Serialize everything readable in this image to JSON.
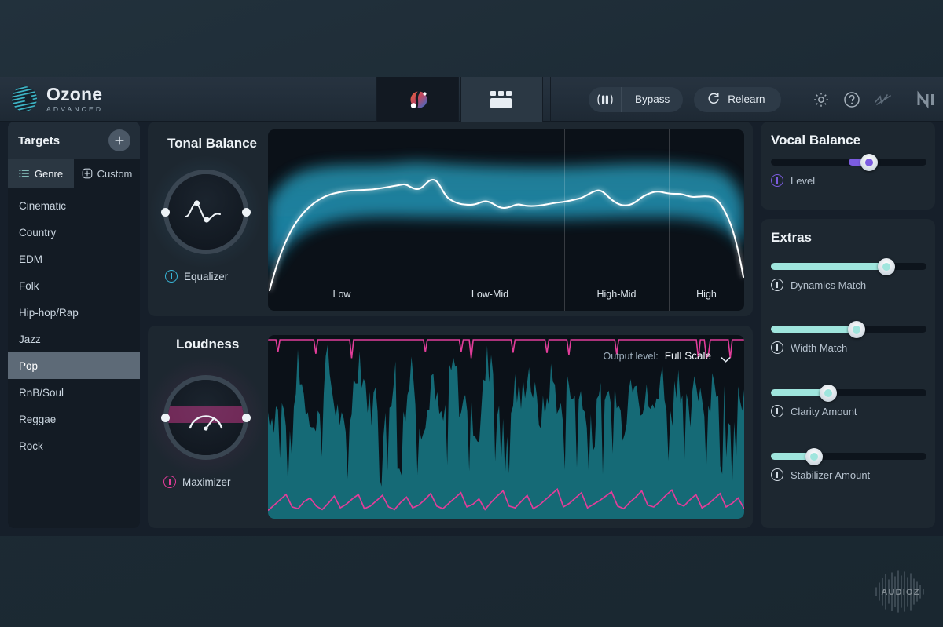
{
  "app": {
    "logo_title": "Ozone",
    "logo_sub": "ADVANCED"
  },
  "header": {
    "tab_assistant_icon": "assistant-orb-icon",
    "tab_modules_icon": "modules-grid-icon",
    "compare_icon": "ab-compare-icon",
    "bypass_label": "Bypass",
    "relearn_label": "Relearn",
    "relearn_icon": "refresh-icon",
    "settings_icon": "gear-icon",
    "help_icon": "help-circle-icon",
    "signal_icon": "signal-wave-icon",
    "brand_icon": "native-instruments-logo"
  },
  "sidebar": {
    "title": "Targets",
    "add_label": "+",
    "tabs": [
      {
        "label": "Genre",
        "icon": "list-icon",
        "active": true
      },
      {
        "label": "Custom",
        "icon": "plus-circle-icon",
        "active": false
      }
    ],
    "genres": [
      {
        "label": "Cinematic",
        "selected": false
      },
      {
        "label": "Country",
        "selected": false
      },
      {
        "label": "EDM",
        "selected": false
      },
      {
        "label": "Folk",
        "selected": false
      },
      {
        "label": "Hip-hop/Rap",
        "selected": false
      },
      {
        "label": "Jazz",
        "selected": false
      },
      {
        "label": "Pop",
        "selected": true
      },
      {
        "label": "RnB/Soul",
        "selected": false
      },
      {
        "label": "Reggae",
        "selected": false
      },
      {
        "label": "Rock",
        "selected": false
      }
    ]
  },
  "tonal_balance": {
    "title": "Tonal Balance",
    "knob_label": "Equalizer",
    "knob_icon": "eq-curve-icon",
    "knob_color": "#38b6d8",
    "bands": [
      "Low",
      "Low-Mid",
      "High-Mid",
      "High"
    ]
  },
  "loudness": {
    "title": "Loudness",
    "knob_label": "Maximizer",
    "knob_icon": "gauge-icon",
    "knob_color": "#e23d9a",
    "output_level_label": "Output level:",
    "output_level_value": "Full Scale",
    "chevron_icon": "chevron-down-icon"
  },
  "vocal_balance": {
    "title": "Vocal Balance",
    "slider": {
      "label": "Level",
      "value_pct": 63,
      "color": "#7c5ce0",
      "bipolar": true,
      "icon": "power-icon"
    }
  },
  "extras": {
    "title": "Extras",
    "sliders": [
      {
        "label": "Dynamics Match",
        "value_pct": 74,
        "color": "#9fe5dd",
        "icon": "power-icon"
      },
      {
        "label": "Width Match",
        "value_pct": 55,
        "color": "#9fe5dd",
        "icon": "power-icon"
      },
      {
        "label": "Clarity Amount",
        "value_pct": 37,
        "color": "#9fe5dd",
        "icon": "power-icon"
      },
      {
        "label": "Stabilizer Amount",
        "value_pct": 28,
        "color": "#9fe5dd",
        "icon": "power-icon"
      }
    ]
  },
  "watermark": {
    "text": "AUDIOZ"
  },
  "chart_data": [
    {
      "type": "area",
      "title": "Tonal Balance",
      "xlabel": "",
      "ylabel": "",
      "categories": [
        "Low",
        "Low-Mid",
        "High-Mid",
        "High"
      ],
      "band_boundaries_pct": [
        31,
        62,
        84
      ],
      "grid": false,
      "legend": "none",
      "series": [
        {
          "name": "Spectrum curve",
          "color": "#ffffff",
          "x": [
            0,
            2,
            4,
            6,
            8,
            10,
            13,
            16,
            19,
            22,
            25,
            28,
            31,
            34,
            37,
            40,
            43,
            46,
            49,
            52,
            55,
            58,
            61,
            64,
            67,
            70,
            73,
            76,
            79,
            82,
            85,
            88,
            91,
            94,
            97,
            100
          ],
          "values": [
            8,
            22,
            38,
            52,
            60,
            65,
            68,
            70,
            71,
            70,
            70,
            71,
            72,
            74,
            70,
            65,
            63,
            62,
            60,
            61,
            60,
            60,
            61,
            62,
            63,
            66,
            68,
            64,
            60,
            63,
            66,
            65,
            64,
            62,
            50,
            28
          ]
        },
        {
          "name": "Target range upper",
          "color": "#2fbde0",
          "x": [
            0,
            5,
            10,
            20,
            30,
            40,
            50,
            60,
            70,
            80,
            90,
            95,
            100
          ],
          "values": [
            55,
            68,
            72,
            74,
            74,
            73,
            72,
            72,
            72,
            73,
            72,
            60,
            40
          ]
        },
        {
          "name": "Target range lower",
          "color": "#2fbde0",
          "x": [
            0,
            5,
            10,
            20,
            30,
            40,
            50,
            60,
            70,
            80,
            90,
            95,
            100
          ],
          "values": [
            10,
            40,
            52,
            54,
            52,
            50,
            50,
            52,
            54,
            55,
            54,
            40,
            12
          ]
        }
      ]
    },
    {
      "type": "area",
      "title": "Loudness",
      "xlabel": "",
      "ylabel": "",
      "grid": false,
      "legend": "none",
      "ceiling_line_color": "#e23d9a",
      "waveform_color": "#156a76",
      "loudness_curve_color": "#e23d9a",
      "series": [
        {
          "name": "Waveform peaks",
          "values": [
            62,
            58,
            74,
            52,
            40,
            95,
            70,
            62,
            48,
            84,
            92,
            66,
            58,
            45,
            70,
            98,
            80,
            62,
            74,
            44,
            66,
            88,
            56,
            70,
            92,
            60,
            48,
            80,
            66,
            54,
            76,
            90,
            62,
            70,
            58,
            46,
            84,
            96,
            70,
            60,
            52,
            78,
            66,
            90,
            74,
            58,
            64,
            82,
            70,
            56,
            88,
            62,
            76,
            48,
            94,
            70,
            60,
            84,
            66,
            52,
            78,
            92,
            64,
            70,
            58,
            86,
            74,
            62,
            90,
            68,
            55,
            80,
            72,
            64,
            88,
            60,
            76,
            50,
            84,
            70
          ]
        },
        {
          "name": "Short-term loudness",
          "values": [
            4,
            10,
            16,
            22,
            8,
            6,
            14,
            18,
            9,
            5,
            12,
            20,
            7,
            11,
            17,
            22,
            6,
            9,
            15,
            21,
            8,
            5,
            13,
            19,
            7,
            10,
            16,
            23,
            9,
            6,
            12,
            18,
            24,
            8,
            11,
            17,
            5,
            13,
            20,
            26,
            9,
            7,
            14,
            21,
            6,
            10,
            16,
            22,
            28,
            8,
            12,
            18,
            24,
            7,
            11,
            15,
            20,
            25,
            9,
            6,
            13,
            19,
            26,
            10,
            8,
            14,
            21,
            27,
            12,
            9,
            16,
            22,
            7,
            11,
            17,
            23,
            8,
            12,
            18,
            6
          ]
        }
      ]
    }
  ]
}
